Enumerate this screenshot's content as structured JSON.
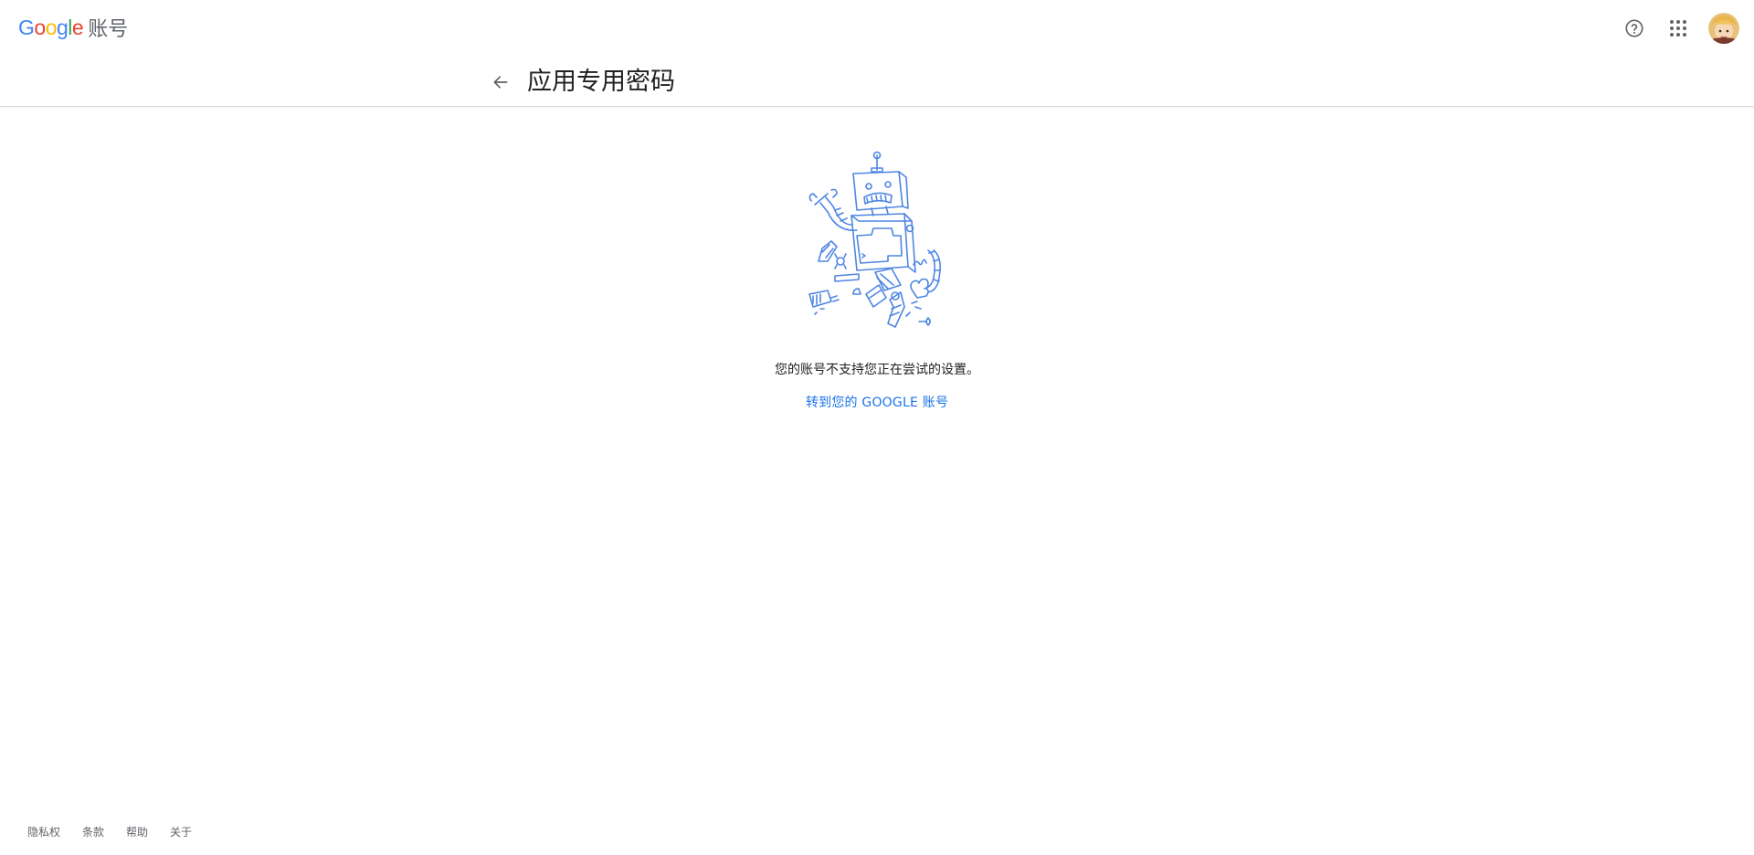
{
  "header": {
    "logo_letters": [
      "G",
      "o",
      "o",
      "g",
      "l",
      "e"
    ],
    "logo_colors": [
      "#4285F4",
      "#EA4335",
      "#FBBC05",
      "#4285F4",
      "#34A853",
      "#EA4335"
    ],
    "product_name": "账号",
    "icons": [
      "help-icon",
      "apps-grid-icon",
      "avatar"
    ]
  },
  "page": {
    "title": "应用专用密码",
    "back_icon": "arrow-back-icon"
  },
  "main": {
    "illustration": "broken-robot-illustration",
    "message": "您的账号不支持您正在尝试的设置。",
    "link_label": "转到您的 GOOGLE 账号",
    "link_color": "#1a73e8"
  },
  "footer": {
    "links": [
      "隐私权",
      "条款",
      "帮助",
      "关于"
    ]
  }
}
